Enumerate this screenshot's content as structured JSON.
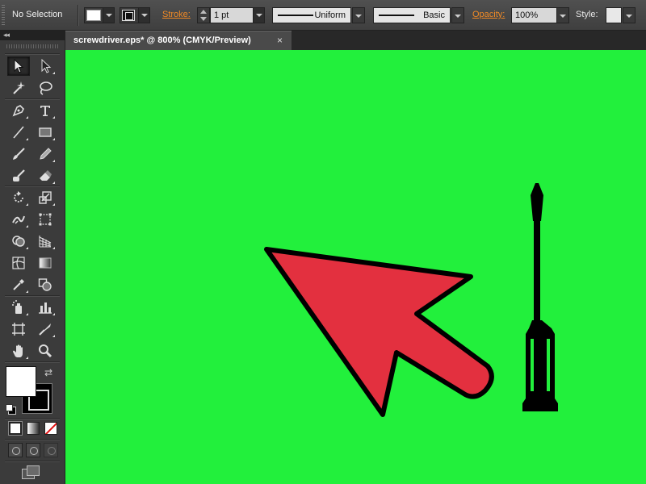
{
  "control_bar": {
    "selection_status": "No Selection",
    "stroke_label": "Stroke:",
    "stroke_weight": "1 pt",
    "variable_width_profile": "Uniform",
    "brush_definition": "Basic",
    "opacity_label": "Opacity:",
    "opacity_value": "100%",
    "style_label": "Style:"
  },
  "document_tab": {
    "title": "screwdriver.eps* @ 800% (CMYK/Preview)",
    "close_glyph": "×"
  },
  "toolbox": {
    "collapse_glyph": "◂◂",
    "swap_glyph": "⇄",
    "tools": [
      "selection-tool",
      "direct-selection-tool",
      "magic-wand-tool",
      "lasso-tool",
      "pen-tool",
      "type-tool",
      "line-segment-tool",
      "rectangle-tool",
      "paintbrush-tool",
      "pencil-tool",
      "blob-brush-tool",
      "eraser-tool",
      "rotate-tool",
      "scale-tool",
      "width-tool",
      "free-transform-tool",
      "shape-builder-tool",
      "perspective-grid-tool",
      "mesh-tool",
      "gradient-tool",
      "eyedropper-tool",
      "blend-tool",
      "symbol-sprayer-tool",
      "column-graph-tool",
      "artboard-tool",
      "slice-tool",
      "hand-tool",
      "zoom-tool"
    ],
    "active_tool": "selection-tool",
    "fill_color": "#ffffff",
    "stroke_color": "#000000"
  },
  "canvas": {
    "background_color": "#22f03c",
    "arrow_color": "#e3303f",
    "outline_color": "#000000"
  }
}
